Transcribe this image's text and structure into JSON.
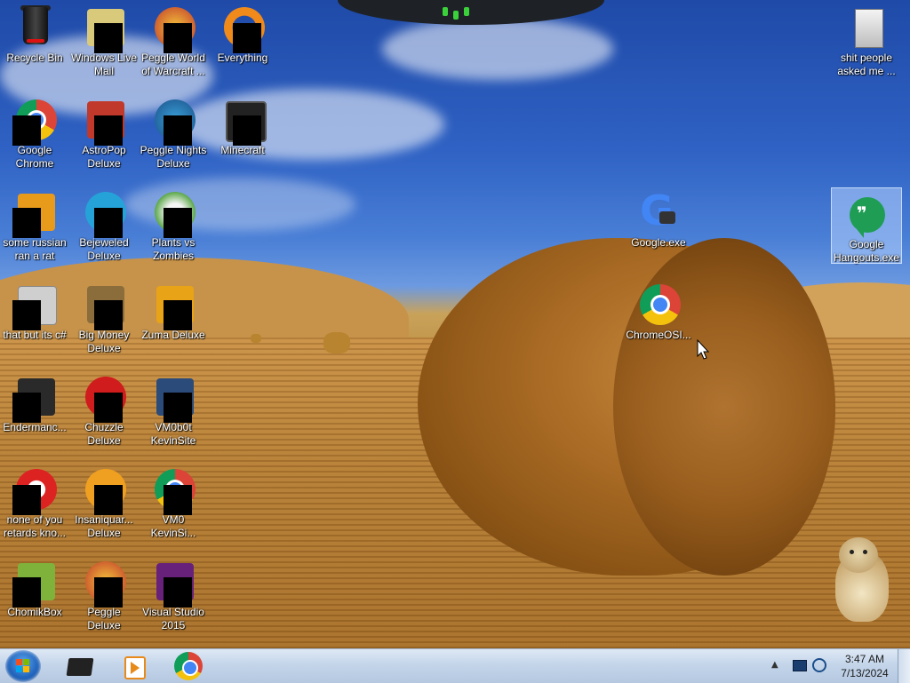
{
  "desktop": {
    "icons": [
      {
        "label": "Recycle Bin"
      },
      {
        "label": "Windows Live Mail"
      },
      {
        "label": "Peggle World of Warcraft ..."
      },
      {
        "label": "Everything"
      },
      {
        "label": "Google Chrome"
      },
      {
        "label": "AstroPop Deluxe"
      },
      {
        "label": "Peggle Nights Deluxe"
      },
      {
        "label": "Minecraft"
      },
      {
        "label": "some russian ran a rat"
      },
      {
        "label": "Bejeweled Deluxe"
      },
      {
        "label": "Plants vs Zombies"
      },
      {
        "label": "that but its c#"
      },
      {
        "label": "Big Money Deluxe"
      },
      {
        "label": "Zuma Deluxe"
      },
      {
        "label": "Endermanc..."
      },
      {
        "label": "Chuzzle Deluxe"
      },
      {
        "label": "VM0b0t KevinSite"
      },
      {
        "label": "none of you retards kno..."
      },
      {
        "label": "Insaniquar... Deluxe"
      },
      {
        "label": "VM0 KevinSi..."
      },
      {
        "label": "ChomikBox"
      },
      {
        "label": "Peggle Deluxe"
      },
      {
        "label": "Visual Studio 2015"
      },
      {
        "label": "shit people asked me ..."
      },
      {
        "label": "Google.exe"
      },
      {
        "label": "ChromeOSI..."
      },
      {
        "label": "Google Hangouts.exe"
      }
    ]
  },
  "taskbar": {
    "pinned": [
      {
        "icon": "terminal-icon"
      },
      {
        "icon": "media-player-icon"
      },
      {
        "icon": "chrome-icon"
      }
    ],
    "clock": {
      "time": "3:47 AM",
      "date": "7/13/2024"
    }
  },
  "colors": {
    "taskbar": "#c4d5ea",
    "selection": "#b4d2ff",
    "chrome_red": "#db4437",
    "chrome_yellow": "#f4c20d",
    "chrome_green": "#0f9d58",
    "chrome_blue": "#4285f4",
    "hangouts_green": "#1f9d55"
  }
}
